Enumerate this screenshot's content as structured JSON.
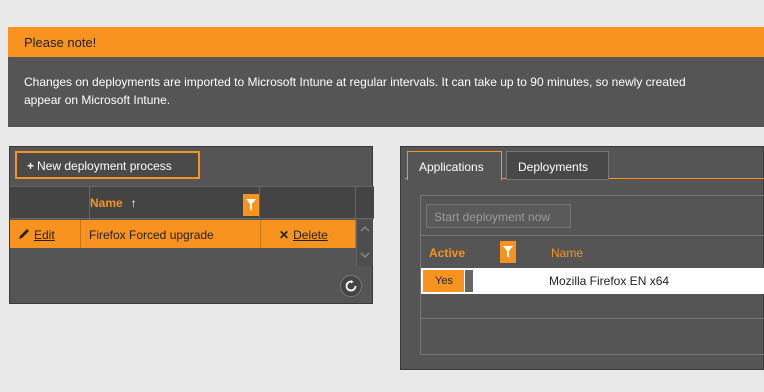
{
  "notice": {
    "title": "Please note!",
    "line1": "Changes on deployments are imported to Microsoft Intune at regular intervals. It can take up to 90 minutes, so newly created",
    "line2": "appear on Microsoft Intune."
  },
  "left_panel": {
    "new_button_label": "New deployment process",
    "columns": {
      "name": "Name",
      "sort_indicator": "↑"
    },
    "rows": [
      {
        "edit_label": "Edit",
        "name": "Firefox Forced upgrade",
        "delete_label": "Delete"
      }
    ]
  },
  "right_panel": {
    "tabs": [
      {
        "label": "Applications",
        "active": true
      },
      {
        "label": "Deployments",
        "active": false
      }
    ],
    "start_button_label": "Start deployment now",
    "columns": {
      "active": "Active",
      "name": "Name"
    },
    "rows": [
      {
        "active": "Yes",
        "name": "Mozilla Firefox EN x64"
      }
    ]
  },
  "colors": {
    "accent": "#f7931e",
    "panel": "#555555",
    "background": "#e9e9e9"
  }
}
